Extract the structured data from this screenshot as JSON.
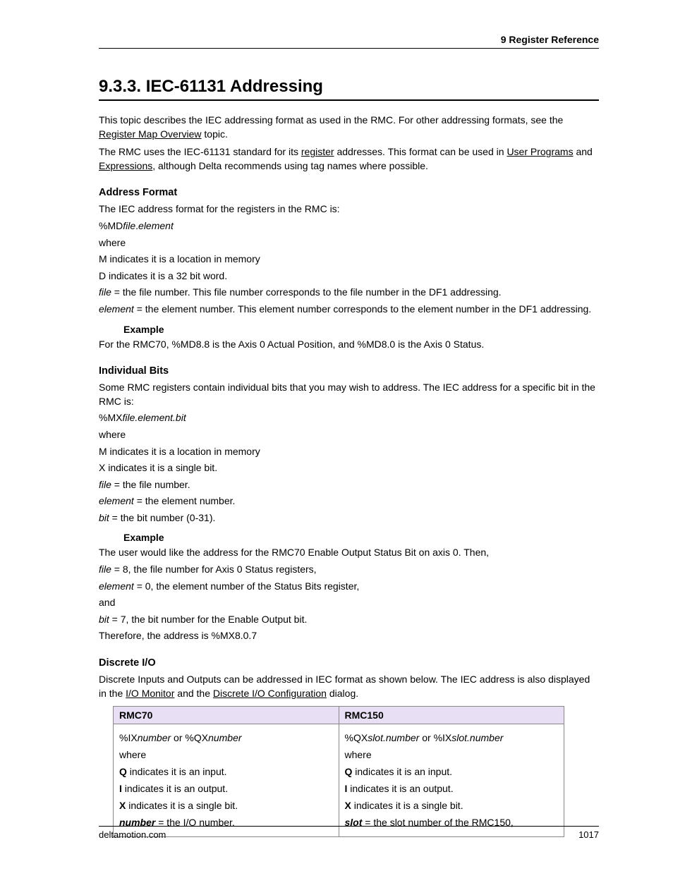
{
  "header": {
    "chapter": "9  Register Reference"
  },
  "title": "9.3.3. IEC-61131 Addressing",
  "intro": {
    "p1a": "This topic describes the IEC addressing format as used in the RMC. For other addressing formats, see the ",
    "p1link": "Register Map Overview",
    "p1b": " topic.",
    "p2a": "The RMC uses the IEC-61131 standard for its ",
    "p2link1": "register",
    "p2b": " addresses. This format can be used in ",
    "p2link2": "User Programs",
    "p2c": " and ",
    "p2link3": "Expressions",
    "p2d": ", although Delta recommends using tag names where possible."
  },
  "address_format": {
    "heading": "Address Format",
    "line1": "The IEC address format for the registers in the RMC is:",
    "format_prefix": "%MD",
    "format_file": "file",
    "format_dot": ".",
    "format_element": "element",
    "where": "where",
    "m": "M indicates it is a location in memory",
    "d": "D indicates it is a 32 bit word.",
    "file_label": "file",
    "file_text": " = the file number. This file number corresponds to the file number in the DF1 addressing.",
    "element_label": "element",
    "element_text": " = the element number. This element number corresponds to the element number in the DF1 addressing.",
    "example_label": "Example",
    "example_text": "For the RMC70, %MD8.8 is the Axis 0 Actual Position, and %MD8.0 is the Axis 0 Status."
  },
  "bits": {
    "heading": "Individual Bits",
    "line1": "Some RMC registers contain individual bits that you may wish to address. The IEC address for a specific bit in the RMC is:",
    "format_prefix": "%MX",
    "format_suffix": "file.element.bit",
    "where": "where",
    "m": "M indicates it is a location in memory",
    "x": "X indicates it is a single bit.",
    "file_label": "file",
    "file_text": " = the file number.",
    "element_label": "element",
    "element_text": " = the element number.",
    "bit_label": "bit",
    "bit_text": " = the bit number (0-31).",
    "example_label": "Example",
    "ex_line1": "The user would like the address for the RMC70 Enable Output Status Bit on axis 0. Then,",
    "ex_file_label": "file",
    "ex_file_text": " = 8, the file number for Axis 0 Status registers,",
    "ex_element_label": "element",
    "ex_element_text": " = 0, the element number of the Status Bits register,",
    "and": "and",
    "ex_bit_label": "bit",
    "ex_bit_text": " = 7, the bit number for the Enable Output bit.",
    "therefore": "Therefore, the address is %MX8.0.7"
  },
  "discrete": {
    "heading": "Discrete I/O",
    "intro_a": "Discrete Inputs and Outputs can be addressed in IEC format as shown below. The IEC address is also displayed in the ",
    "intro_link1": "I/O Monitor",
    "intro_b": " and the ",
    "intro_link2": "Discrete I/O Configuration",
    "intro_c": " dialog.",
    "table": {
      "h1": "RMC70",
      "h2": "RMC150",
      "c70": {
        "fmt_a": "%IX",
        "fmt_num1": "number",
        "fmt_or": " or %QX",
        "fmt_num2": "number",
        "where": "where",
        "q_b": "Q",
        "q_t": " indicates it is an input.",
        "i_b": "I",
        "i_t": " indicates it is an output.",
        "x_b": "X",
        "x_t": " indicates it is a single bit.",
        "n_b": "number",
        "n_t": " = the I/O number."
      },
      "c150": {
        "fmt_a": "%QX",
        "fmt_s1": "slot.number",
        "fmt_or": " or %IX",
        "fmt_s2": "slot.number",
        "where": "where",
        "q_b": "Q",
        "q_t": " indicates it is an input.",
        "i_b": "I",
        "i_t": " indicates it is an output.",
        "x_b": "X",
        "x_t": " indicates it is a single bit.",
        "s_b": "slot",
        "s_t": " = the slot number of the RMC150,"
      }
    }
  },
  "footer": {
    "site": "deltamotion.com",
    "page": "1017"
  }
}
